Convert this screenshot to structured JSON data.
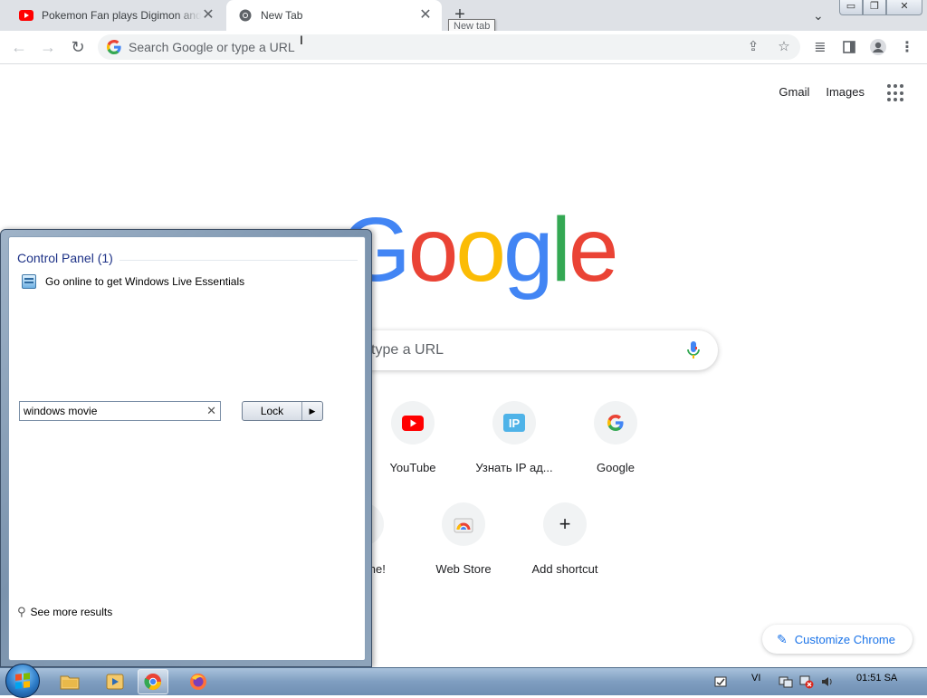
{
  "tabs": [
    {
      "title": "Pokemon Fan plays Digimon and",
      "favicon": "youtube-icon",
      "active": false
    },
    {
      "title": "New Tab",
      "favicon": "chrome-icon",
      "active": true
    }
  ],
  "new_tab_tooltip": "New tab",
  "omnibox": {
    "placeholder": "Search Google or type a URL"
  },
  "ntp": {
    "links": {
      "gmail": "Gmail",
      "images": "Images"
    },
    "logo": [
      "G",
      "o",
      "o",
      "g",
      "l",
      "e"
    ],
    "search_visible_text": "type a URL",
    "shortcuts_row1": [
      {
        "label": "YouTube",
        "icon": "youtube-icon"
      },
      {
        "label": "Узнать IP ад...",
        "icon": "ip-icon"
      },
      {
        "label": "Google",
        "icon": "google-icon"
      }
    ],
    "shortcuts_row2": [
      {
        "label": "me!",
        "icon": "partial-icon"
      },
      {
        "label": "Web Store",
        "icon": "webstore-icon"
      },
      {
        "label": "Add shortcut",
        "icon": "plus-icon"
      }
    ],
    "customize": "Customize Chrome"
  },
  "startmenu": {
    "group_header": "Control Panel (1)",
    "results": [
      "Go online to get Windows Live Essentials"
    ],
    "see_more": "See more results",
    "search_value": "windows movie",
    "lock_label": "Lock"
  },
  "taskbar": {
    "apps": [
      "explorer-icon",
      "media-player-icon",
      "chrome-icon",
      "firefox-icon"
    ],
    "language": "VI",
    "clock": "01:51 SA"
  },
  "colors": {
    "google_blue": "#4285f4",
    "google_red": "#ea4335",
    "google_yellow": "#fbbc05",
    "google_green": "#34a853",
    "link_blue": "#1a73e8"
  }
}
